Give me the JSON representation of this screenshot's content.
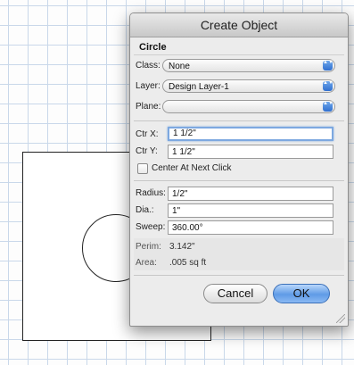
{
  "dialog": {
    "title": "Create Object",
    "section": "Circle",
    "class_label": "Class:",
    "class_value": "None",
    "layer_label": "Layer:",
    "layer_value": "Design Layer-1",
    "plane_label": "Plane:",
    "plane_value": "",
    "ctrx_label": "Ctr X:",
    "ctrx_value": "1 1/2\"",
    "ctry_label": "Ctr Y:",
    "ctry_value": "1 1/2\"",
    "center_next_click_label": "Center At Next Click",
    "center_next_click_checked": false,
    "radius_label": "Radius:",
    "radius_value": "1/2\"",
    "dia_label": "Dia.:",
    "dia_value": "1\"",
    "sweep_label": "Sweep:",
    "sweep_value": "360.00°",
    "perim_label": "Perim:",
    "perim_value": "3.142\"",
    "area_label": "Area:",
    "area_value": ".005 sq ft",
    "cancel_label": "Cancel",
    "ok_label": "OK",
    "popup_arrows": "▲▼"
  },
  "colors": {
    "grid_line": "#c9d8ea",
    "focus_ring": "#7da8e0",
    "default_button": "#5f9be6"
  }
}
